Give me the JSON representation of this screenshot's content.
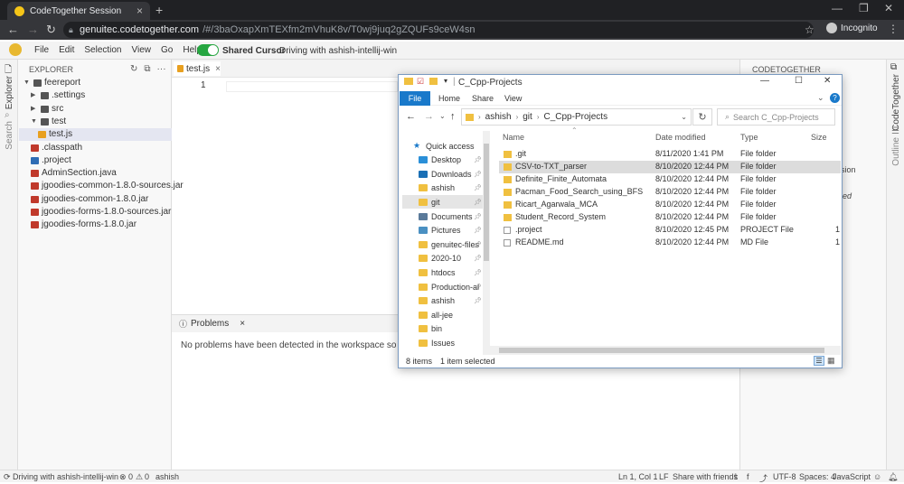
{
  "browser": {
    "tab_title": "CodeTogether Session",
    "url_domain": "genuitec.codetogether.com",
    "url_path": "/#/3baOxapXmTEXfm2mVhuK8v/T0wj9juq2gZQUFs9ceW4sn",
    "incognito_label": "Incognito"
  },
  "ide": {
    "menu": [
      "File",
      "Edit",
      "Selection",
      "View",
      "Go",
      "Help"
    ],
    "shared_cursor": "Shared Cursor",
    "driving_text": "Driving with ashish-intellij-win",
    "left_tabs": [
      "Explorer",
      "Search"
    ],
    "explorer_title": "EXPLORER",
    "tree": [
      {
        "label": "feereport",
        "indent": 0,
        "kind": "folder-open"
      },
      {
        "label": ".settings",
        "indent": 1,
        "kind": "folder"
      },
      {
        "label": "src",
        "indent": 1,
        "kind": "folder"
      },
      {
        "label": "test",
        "indent": 1,
        "kind": "folder-open"
      },
      {
        "label": "test.js",
        "indent": 2,
        "kind": "js",
        "selected": true
      },
      {
        "label": ".classpath",
        "indent": 1,
        "kind": "xml"
      },
      {
        "label": ".project",
        "indent": 1,
        "kind": "project"
      },
      {
        "label": "AdminSection.java",
        "indent": 1,
        "kind": "java"
      },
      {
        "label": "jgoodies-common-1.8.0-sources.jar",
        "indent": 1,
        "kind": "jar"
      },
      {
        "label": "jgoodies-common-1.8.0.jar",
        "indent": 1,
        "kind": "jar"
      },
      {
        "label": "jgoodies-forms-1.8.0-sources.jar",
        "indent": 1,
        "kind": "jar"
      },
      {
        "label": "jgoodies-forms-1.8.0.jar",
        "indent": 1,
        "kind": "jar"
      }
    ],
    "editor_tab": "test.js",
    "line_number": "1",
    "problems_tab": "Problems",
    "problems_message": "No problems have been detected in the workspace so far.",
    "right_title": "CODETOGETHER",
    "right_tabs": [
      "CodeTogether",
      "Outline"
    ],
    "right_fragments": [
      "sion",
      "ed"
    ],
    "status": {
      "left": "Driving with ashish-intellij-win",
      "errors": "0",
      "warnings": "0",
      "user": "ashish",
      "position": "Ln 1, Col 1",
      "eol": "LF",
      "share": "Share with friends",
      "encoding": "UTF-8",
      "spaces": "Spaces: 4",
      "language": "JavaScript"
    }
  },
  "file_explorer": {
    "title": "C_Cpp-Projects",
    "ribbon_tabs": [
      "File",
      "Home",
      "Share",
      "View"
    ],
    "breadcrumb": [
      "ashish",
      "git",
      "C_Cpp-Projects"
    ],
    "search_placeholder": "Search C_Cpp-Projects",
    "nav": [
      {
        "label": "Quick access",
        "icon": "star"
      },
      {
        "label": "Desktop",
        "icon": "desktop",
        "pinned": true
      },
      {
        "label": "Downloads",
        "icon": "download",
        "pinned": true
      },
      {
        "label": "ashish",
        "icon": "folder",
        "pinned": true
      },
      {
        "label": "git",
        "icon": "folder",
        "pinned": true,
        "selected": true
      },
      {
        "label": "Documents",
        "icon": "documents",
        "pinned": true
      },
      {
        "label": "Pictures",
        "icon": "pictures",
        "pinned": true
      },
      {
        "label": "genuitec-files",
        "icon": "folder",
        "pinned": true
      },
      {
        "label": "2020-10",
        "icon": "folder",
        "pinned": true
      },
      {
        "label": "htdocs",
        "icon": "folder",
        "pinned": true
      },
      {
        "label": "Production-al",
        "icon": "folder",
        "pinned": true
      },
      {
        "label": "ashish",
        "icon": "folder",
        "pinned": true
      },
      {
        "label": "all-jee",
        "icon": "folder"
      },
      {
        "label": "bin",
        "icon": "folder"
      },
      {
        "label": "Issues",
        "icon": "folder"
      }
    ],
    "columns": [
      "Name",
      "Date modified",
      "Type",
      "Size"
    ],
    "files": [
      {
        "name": ".git",
        "date": "8/11/2020 1:41 PM",
        "type": "File folder",
        "size": "",
        "icon": "folder"
      },
      {
        "name": "CSV-to-TXT_parser",
        "date": "8/10/2020 12:44 PM",
        "type": "File folder",
        "size": "",
        "icon": "folder",
        "selected": true
      },
      {
        "name": "Definite_Finite_Automata",
        "date": "8/10/2020 12:44 PM",
        "type": "File folder",
        "size": "",
        "icon": "folder"
      },
      {
        "name": "Pacman_Food_Search_using_BFS",
        "date": "8/10/2020 12:44 PM",
        "type": "File folder",
        "size": "",
        "icon": "folder"
      },
      {
        "name": "Ricart_Agarwala_MCA",
        "date": "8/10/2020 12:44 PM",
        "type": "File folder",
        "size": "",
        "icon": "folder"
      },
      {
        "name": "Student_Record_System",
        "date": "8/10/2020 12:44 PM",
        "type": "File folder",
        "size": "",
        "icon": "folder"
      },
      {
        "name": ".project",
        "date": "8/10/2020 12:45 PM",
        "type": "PROJECT File",
        "size": "1",
        "icon": "file"
      },
      {
        "name": "README.md",
        "date": "8/10/2020 12:44 PM",
        "type": "MD File",
        "size": "1",
        "icon": "file"
      }
    ],
    "status_items": "8 items",
    "status_selected": "1 item selected"
  }
}
